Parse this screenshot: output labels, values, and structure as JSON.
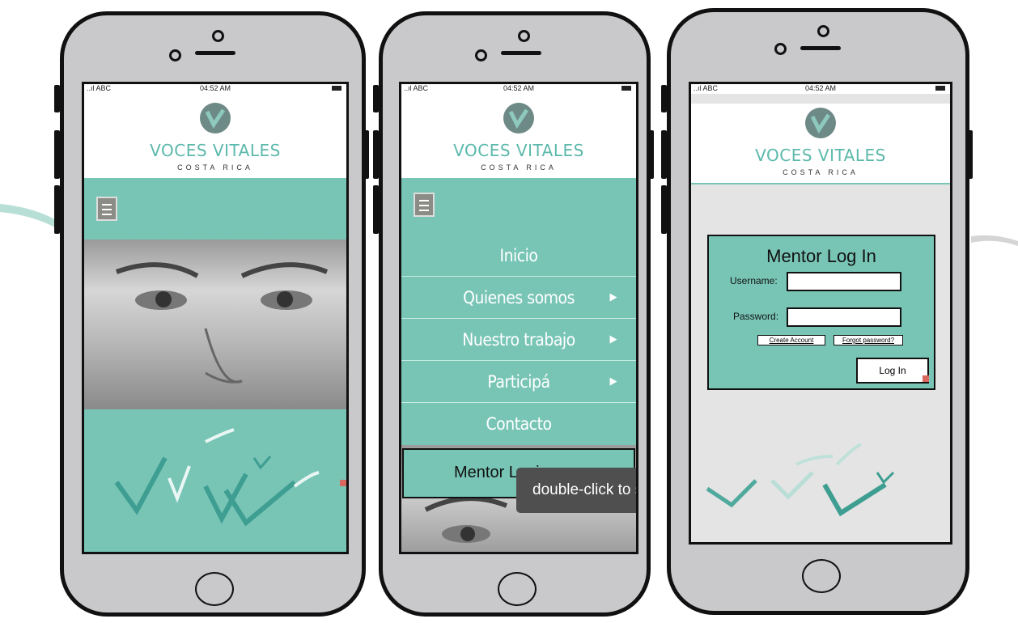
{
  "status": {
    "signal": "..ıl ABC",
    "time": "04:52 AM"
  },
  "brand": {
    "name": "VOCES VITALES",
    "subtitle": "COSTA RICA"
  },
  "menu": {
    "items": [
      {
        "label": "Inicio",
        "has_arrow": false
      },
      {
        "label": "Quienes somos",
        "has_arrow": true
      },
      {
        "label": "Nuestro trabajo",
        "has_arrow": true
      },
      {
        "label": "Participá",
        "has_arrow": true
      },
      {
        "label": "Contacto",
        "has_arrow": false
      }
    ],
    "arrow_glyph": "▶",
    "mentor_login_label": "Mentor Login"
  },
  "tooltip": {
    "text": "double-click to se"
  },
  "login": {
    "title": "Mentor Log In",
    "username_label": "Username:",
    "password_label": "Password:",
    "create_account": "Create Account",
    "forgot_password": "Forgot password?",
    "login_button": "Log In"
  },
  "colors": {
    "teal": "#78c5b6",
    "brand_text": "#5bb8ab",
    "dark": "#111111"
  }
}
